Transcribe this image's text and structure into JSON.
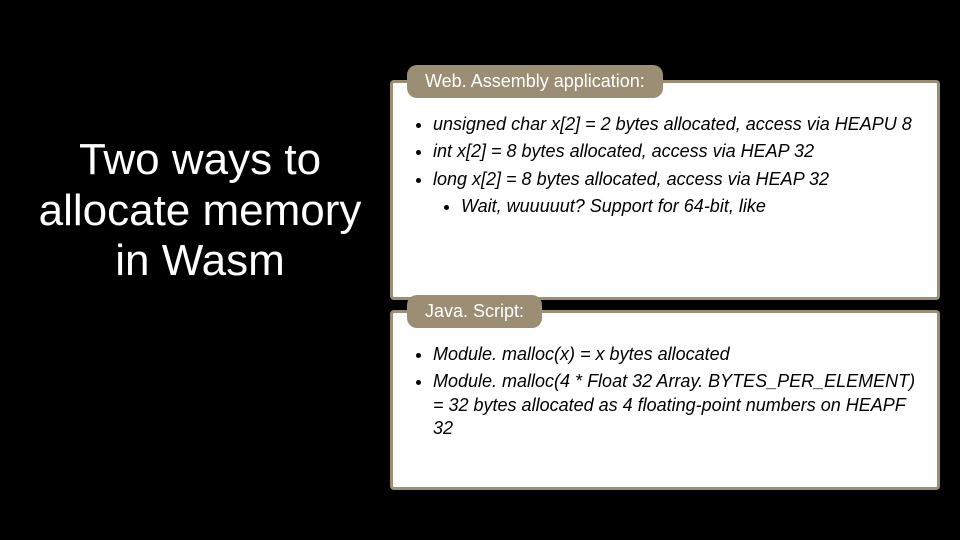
{
  "title": "Two ways to allocate memory in Wasm",
  "panels": [
    {
      "label": "Web. Assembly application:",
      "items": [
        "unsigned char x[2] = 2 bytes allocated, access via HEAPU 8",
        "int x[2] = 8 bytes allocated, access via HEAP 32",
        "long x[2] = 8 bytes allocated, access via HEAP 32"
      ],
      "subitem": "Wait, wuuuuut? Support for 64-bit, like"
    },
    {
      "label": "Java. Script:",
      "items": [
        "Module. malloc(x) = x bytes allocated",
        "Module. malloc(4 * Float 32 Array. BYTES_PER_ELEMENT) = 32 bytes allocated as 4 floating-point numbers on HEAPF 32"
      ]
    }
  ]
}
